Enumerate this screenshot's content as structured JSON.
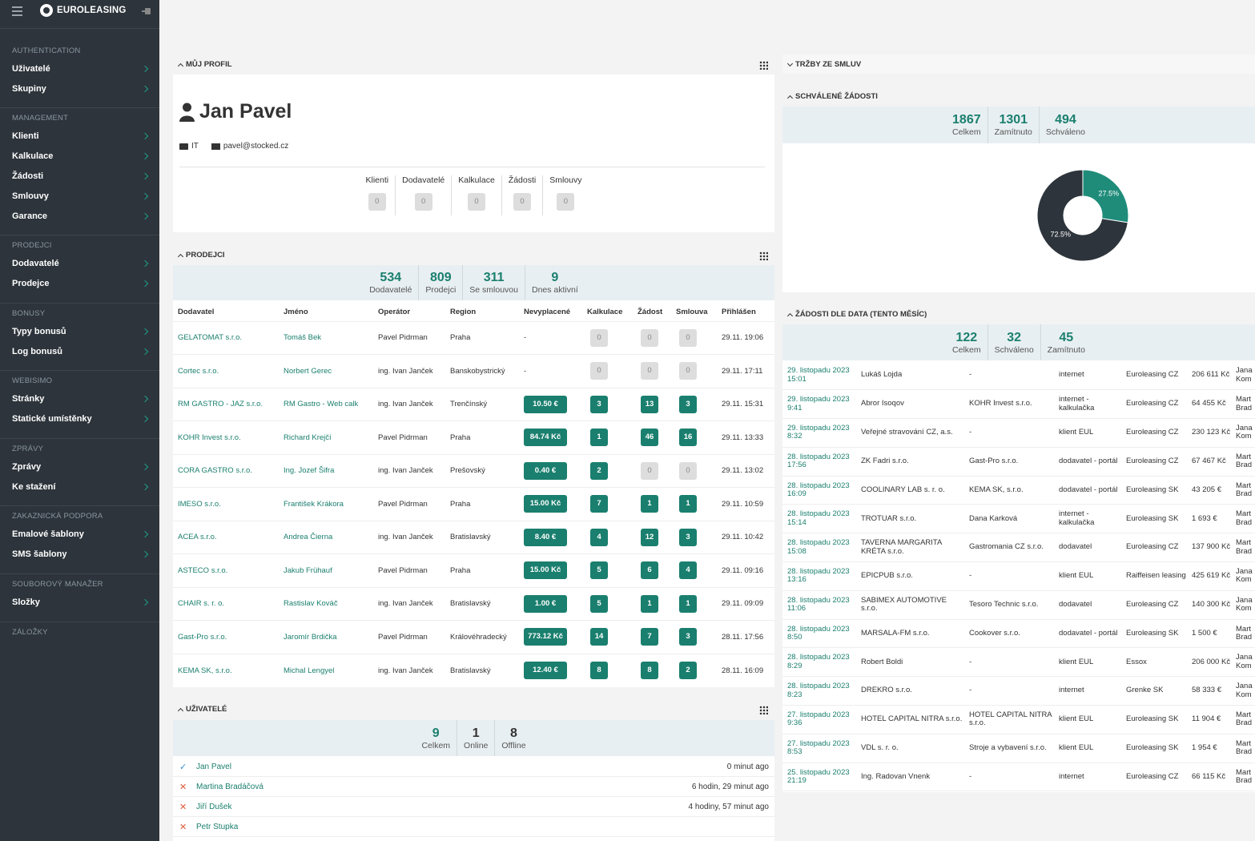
{
  "app": {
    "brand": "EUROLEASING"
  },
  "sidebar": {
    "sections": [
      {
        "head": "AUTHENTICATION",
        "items": [
          "Uživatelé",
          "Skupiny"
        ]
      },
      {
        "head": "MANAGEMENT",
        "items": [
          "Klienti",
          "Kalkulace",
          "Žádosti",
          "Smlouvy",
          "Garance"
        ]
      },
      {
        "head": "PRODEJCI",
        "items": [
          "Dodavatelé",
          "Prodejce"
        ]
      },
      {
        "head": "BONUSY",
        "items": [
          "Typy bonusů",
          "Log bonusů"
        ]
      },
      {
        "head": "WEBISIMO",
        "items": [
          "Stránky",
          "Statické umístěnky"
        ]
      },
      {
        "head": "ZPRÁVY",
        "items": [
          "Zprávy",
          "Ke stažení"
        ]
      },
      {
        "head": "ZAKAZNICKÁ PODPORA",
        "items": [
          "Emalové šablony",
          "SMS šablony"
        ]
      },
      {
        "head": "SOUBOROVÝ MANAŽER",
        "items": [
          "Složky"
        ]
      },
      {
        "head": "ZÁLOŽKY",
        "items": []
      }
    ]
  },
  "profile": {
    "title": "MŮJ PROFIL",
    "name": "Jan Pavel",
    "department": "IT",
    "email": "pavel@stocked.cz",
    "counters": [
      {
        "label": "Klienti",
        "value": "0"
      },
      {
        "label": "Dodavatelé",
        "value": "0"
      },
      {
        "label": "Kalkulace",
        "value": "0"
      },
      {
        "label": "Žádosti",
        "value": "0"
      },
      {
        "label": "Smlouvy",
        "value": "0"
      }
    ]
  },
  "prodejci": {
    "title": "PRODEJCI",
    "stats": [
      {
        "num": "534",
        "lbl": "Dodavatelé"
      },
      {
        "num": "809",
        "lbl": "Prodejci"
      },
      {
        "num": "311",
        "lbl": "Se smlouvou"
      },
      {
        "num": "9",
        "lbl": "Dnes aktivní"
      }
    ],
    "columns": [
      "Dodavatel",
      "Jméno",
      "Operátor",
      "Region",
      "Nevyplacené",
      "Kalkulace",
      "Žádost",
      "Smlouva",
      "Přihlášen"
    ],
    "rows": [
      [
        "GELATOMAT s.r.o.",
        "Tomáš Bek",
        "Pavel Pidrman",
        "Praha",
        "-",
        "0",
        "0",
        "0",
        "29.11. 19:06"
      ],
      [
        "Cortec s.r.o.",
        "Norbert Gerec",
        "ing. Ivan Janček",
        "Banskobystrický",
        "-",
        "0",
        "0",
        "0",
        "29.11. 17:11"
      ],
      [
        "RM GASTRO - JAZ s.r.o.",
        "RM Gastro - Web calk",
        "ing. Ivan Janček",
        "Trenčínský",
        "10.50 €",
        "3",
        "13",
        "3",
        "29.11. 15:31"
      ],
      [
        "KOHR Invest s.r.o.",
        "Richard Krejčí",
        "Pavel Pidrman",
        "Praha",
        "84.74 Kč",
        "1",
        "46",
        "16",
        "29.11. 13:33"
      ],
      [
        "CORA GASTRO s.r.o.",
        "Ing. Jozef Šifra",
        "ing. Ivan Janček",
        "Prešovský",
        "0.40 €",
        "2",
        "0",
        "0",
        "29.11. 13:02"
      ],
      [
        "IMESO s.r.o.",
        "František Krákora",
        "Pavel Pidrman",
        "Praha",
        "15.00 Kč",
        "7",
        "1",
        "1",
        "29.11. 10:59"
      ],
      [
        "ACEA s.r.o.",
        "Andrea Čierna",
        "ing. Ivan Janček",
        "Bratislavský",
        "8.40 €",
        "4",
        "12",
        "3",
        "29.11. 10:42"
      ],
      [
        "ASTECO s.r.o.",
        "Jakub Frühauf",
        "Pavel Pidrman",
        "Praha",
        "15.00 Kč",
        "5",
        "6",
        "4",
        "29.11. 09:16"
      ],
      [
        "CHAIR s. r. o.",
        "Rastislav Kováč",
        "ing. Ivan Janček",
        "Bratislavský",
        "1.00 €",
        "5",
        "1",
        "1",
        "29.11. 09:09"
      ],
      [
        "Gast-Pro s.r.o.",
        "Jaromír Brdička",
        "Pavel Pidrman",
        "Královéhradecký",
        "773.12 Kč",
        "14",
        "7",
        "3",
        "28.11. 17:56"
      ],
      [
        "KEMA SK, s.r.o.",
        "Michal Lengyel",
        "ing. Ivan Janček",
        "Bratislavský",
        "12.40 €",
        "8",
        "8",
        "2",
        "28.11. 16:09"
      ]
    ]
  },
  "uzivatele": {
    "title": "UŽIVATELÉ",
    "stats": [
      {
        "num": "9",
        "lbl": "Celkem"
      },
      {
        "num": "1",
        "lbl": "Online"
      },
      {
        "num": "8",
        "lbl": "Offline"
      }
    ],
    "rows": [
      {
        "name": "Jan Pavel",
        "time": "0 minut ago",
        "online": true
      },
      {
        "name": "Martina Bradáčová",
        "time": "6 hodin, 29 minut ago",
        "online": false
      },
      {
        "name": "Jiří Dušek",
        "time": "4 hodiny, 57 minut ago",
        "online": false
      },
      {
        "name": "Petr Stupka",
        "time": "",
        "online": false
      }
    ]
  },
  "trzby": {
    "title": "TRŽBY ZE SMLUV"
  },
  "schvalene": {
    "title": "SCHVÁLENÉ ŽÁDOSTI",
    "stats": [
      {
        "num": "1867",
        "lbl": "Celkem"
      },
      {
        "num": "1301",
        "lbl": "Zamítnuto"
      },
      {
        "num": "494",
        "lbl": "Schváleno"
      }
    ]
  },
  "chart_data": {
    "type": "pie",
    "categories": [
      "Schváleno",
      "Zamítnuto"
    ],
    "values": [
      27.5,
      72.5
    ],
    "labels": [
      "27.5%",
      "72.5%"
    ],
    "colors": [
      "#1f8c7a",
      "#2d343b"
    ]
  },
  "zadosti": {
    "title": "ŽÁDOSTI DLE DATA (TENTO MĚSÍC)",
    "stats": [
      {
        "num": "122",
        "lbl": "Celkem"
      },
      {
        "num": "32",
        "lbl": "Schváleno"
      },
      {
        "num": "45",
        "lbl": "Zamítnuto"
      }
    ],
    "rows": [
      [
        "29. listopadu 2023 15:01",
        "Lukáš Lojda",
        "-",
        "internet",
        "Euroleasing CZ",
        "206 611 Kč",
        "Jana Kom"
      ],
      [
        "29. listopadu 2023 9:41",
        "Abror Isoqov",
        "KOHR Invest s.r.o.",
        "internet - kalkulačka",
        "Euroleasing CZ",
        "64 455 Kč",
        "Mart Brad"
      ],
      [
        "29. listopadu 2023 8:32",
        "Veřejné stravování CZ, a.s.",
        "-",
        "klient EUL",
        "Euroleasing CZ",
        "230 123 Kč",
        "Jana Kom"
      ],
      [
        "28. listopadu 2023 17:56",
        "ZK Fadri s.r.o.",
        "Gast-Pro s.r.o.",
        "dodavatel - portál",
        "Euroleasing CZ",
        "67 467 Kč",
        "Mart Brad"
      ],
      [
        "28. listopadu 2023 16:09",
        "COOLINARY LAB s. r. o.",
        "KEMA SK, s.r.o.",
        "dodavatel - portál",
        "Euroleasing SK",
        "43 205 €",
        "Mart Brad"
      ],
      [
        "28. listopadu 2023 15:14",
        "TROTUAR s.r.o.",
        "Dana Karková",
        "internet - kalkulačka",
        "Euroleasing SK",
        "1 693 €",
        "Mart Brad"
      ],
      [
        "28. listopadu 2023 15:08",
        "TAVERNA MARGARITA KRÉTA s.r.o.",
        "Gastromania CZ s.r.o.",
        "dodavatel",
        "Euroleasing CZ",
        "137 900 Kč",
        "Mart Brad"
      ],
      [
        "28. listopadu 2023 13:16",
        "EPICPUB s.r.o.",
        "-",
        "klient EUL",
        "Raiffeisen leasing",
        "425 619 Kč",
        "Jana Kom"
      ],
      [
        "28. listopadu 2023 11:06",
        "SABIMEX AUTOMOTIVE s.r.o.",
        "Tesoro Technic s.r.o.",
        "dodavatel",
        "Euroleasing CZ",
        "140 300 Kč",
        "Jana Kom"
      ],
      [
        "28. listopadu 2023 8:50",
        "MARSALA-FM s.r.o.",
        "Cookover s.r.o.",
        "dodavatel - portál",
        "Euroleasing SK",
        "1 500 €",
        "Mart Brad"
      ],
      [
        "28. listopadu 2023 8:29",
        "Robert Boldi",
        "-",
        "klient EUL",
        "Essox",
        "206 000 Kč",
        "Jana Kom"
      ],
      [
        "28. listopadu 2023 8:23",
        "DREKRO s.r.o.",
        "-",
        "internet",
        "Grenke SK",
        "58 333 €",
        "Jana Kom"
      ],
      [
        "27. listopadu 2023 9:36",
        "HOTEL CAPITAL NITRA s.r.o.",
        "HOTEL CAPITAL NITRA s.r.o.",
        "klient EUL",
        "Euroleasing SK",
        "11 904 €",
        "Mart Brad"
      ],
      [
        "27. listopadu 2023 8:53",
        "VDL s. r. o.",
        "Stroje a vybavení s.r.o.",
        "klient EUL",
        "Euroleasing SK",
        "1 954 €",
        "Mart Brad"
      ],
      [
        "25. listopadu 2023 21:19",
        "Ing. Radovan Vnenk",
        "-",
        "internet",
        "Euroleasing CZ",
        "66 115 Kč",
        "Mart Brad"
      ]
    ]
  }
}
